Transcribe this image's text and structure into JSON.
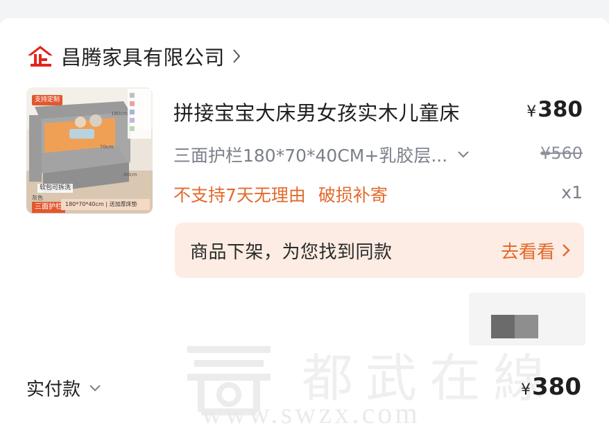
{
  "shop": {
    "name": "昌腾家具有限公司",
    "logo_icon": "shop-logo-icon",
    "brand_color": "#e3231d"
  },
  "product": {
    "title": "拼接宝宝大床男女孩实木儿童床",
    "price_currency": "¥",
    "price": "380",
    "spec": "三面护栏180*70*40CM+乳胶层...",
    "original_price": "¥560",
    "notices": [
      "不支持7天无理由",
      "破损补寄"
    ],
    "quantity": "x1",
    "thumbnail": {
      "tag_top": "支持定制",
      "tag_removable": "软包可拆洗",
      "tag_color": "灰色",
      "tag_three_sides": "三面护栏",
      "tag_size": "180*70*40cm  |  送加厚床垫",
      "dim_length": "180cm",
      "dim_width": "70cm",
      "dim_height": "40cm"
    }
  },
  "banner": {
    "text": "商品下架，为您找到同款",
    "link_label": "去看看"
  },
  "payment": {
    "label": "实付款",
    "currency": "¥",
    "total": "380"
  },
  "watermark": {
    "hanzi": "都武在線",
    "url": "www.swzx.com"
  },
  "colors": {
    "accent_orange": "#e36a2c",
    "banner_bg": "#fdece3",
    "muted_text": "#7a7f8a"
  }
}
